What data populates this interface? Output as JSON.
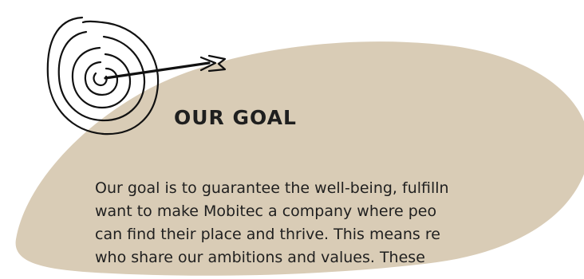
{
  "section": {
    "title": "OUR GOAL",
    "icon": "target-arrow-icon",
    "background_color": "#d9ccb6",
    "text_color": "#1f1f1f"
  },
  "paragraph": {
    "lines": [
      "Our goal is to guarantee the well-being, fulfilln",
      "want to make Mobitec a company where peo",
      "can find their place and thrive. This means re",
      "who share our ambitions and values. These"
    ]
  }
}
